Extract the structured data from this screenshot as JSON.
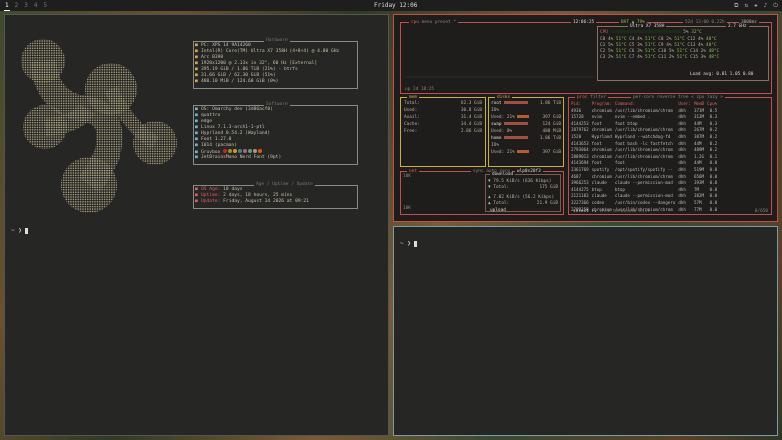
{
  "topbar": {
    "workspaces": [
      "1",
      "2",
      "3",
      "4",
      "5"
    ],
    "clock": "Friday 12:06",
    "tray": [
      "⧉",
      "⇅",
      "✚",
      "♪",
      "⏻"
    ]
  },
  "term1": {
    "prompt": "~ ❯",
    "sysbox_title": "Hardware",
    "sys_lines": [
      {
        "icon": "▪",
        "key": "PC:",
        "val": "XPS 14 9A14260"
      },
      {
        "icon": "▪",
        "key": "",
        "val": "Intel(R) Core(TM) Ultra X7 358H (4+8+4) @ 4.80 GHz"
      },
      {
        "icon": "▪",
        "key": "",
        "val": "Arc B390"
      },
      {
        "icon": "▪",
        "key": "",
        "val": "1920x1200 @ 2.13x in 32\", 60 Hz [External]"
      },
      {
        "icon": "▪",
        "key": "",
        "val": "395.19 GiB / 1.86 TiB (21%) - btrfs"
      },
      {
        "icon": "▪",
        "key": "",
        "val": "31.66 GiB / 62.30 GiB (51%)"
      },
      {
        "icon": "▪",
        "key": "",
        "val": "480.10 MiB / 124.60 GiB (0%)"
      }
    ],
    "swbox_title": "Software",
    "sw_lines": [
      {
        "key": "OS:",
        "val": "Omarchy dev (3d86acf0)"
      },
      {
        "key": "",
        "val": "quattro"
      },
      {
        "key": "",
        "val": "edge"
      },
      {
        "key": "",
        "val": "Linux 7.1.3-arch1-1-ptl"
      },
      {
        "key": "",
        "val": "Hyprland 0.54.2 (Wayland)"
      },
      {
        "key": "",
        "val": "Foot 1.27.0"
      },
      {
        "key": "",
        "val": "1014 (pacman)"
      },
      {
        "key": "",
        "val": "Gruvbox"
      },
      {
        "key": "",
        "val": "JetBrainsMono Nerd Font (9pt)"
      }
    ],
    "upbox_title": "Age / Uptime / Update",
    "up_lines": [
      {
        "key": "OS Age:",
        "val": "10 days"
      },
      {
        "key": "Uptime:",
        "val": "2 days, 18 hours, 25 mins"
      },
      {
        "key": "Update:",
        "val": "Friday, August 14 2026 at 09:21"
      }
    ],
    "palette": [
      "#cc241d",
      "#98971a",
      "#d79921",
      "#458588",
      "#b16286",
      "#689d6a",
      "#a89984",
      "#d65d0e"
    ]
  },
  "btop": {
    "cpu_title": "cpu",
    "menu": "menu",
    "preset": "preset *",
    "time": "12:06:25",
    "bat": "BAT ▲ 79%",
    "uptime_hdr": "52d 13:00 0.22h",
    "freq": "3000ms",
    "up": "up 2d 18:25",
    "cpu_model": "Ultra X7 358H",
    "cpu_total_ghz": "2.7 GHz",
    "cpu_rows": [
      [
        "CPU",
        "5%",
        "32°C"
      ],
      [
        "C0",
        "4%",
        "51°C",
        "C4",
        "4%",
        "51°C",
        "C8",
        "2%",
        "51°C",
        "C12",
        "4%",
        "48°C"
      ],
      [
        "C1",
        "5%",
        "51°C",
        "C5",
        "3%",
        "51°C",
        "C9",
        "4%",
        "51°C",
        "C13",
        "4%",
        "48°C"
      ],
      [
        "C2",
        "5%",
        "51°C",
        "C6",
        "3%",
        "51°C",
        "C10",
        "5%",
        "51°C",
        "C14",
        "2%",
        "48°C"
      ],
      [
        "C3",
        "2%",
        "51°C",
        "C7",
        "4%",
        "51°C",
        "C11",
        "2%",
        "51°C",
        "C15",
        "3%",
        "48°C"
      ]
    ],
    "load_avg": "Load avg: 0.81 1.05 0.80",
    "mem_title": "mem",
    "mem": [
      [
        "Total:",
        "62.3 GiB"
      ],
      [
        "Used:",
        "30.8 GiB"
      ],
      [
        "Avail:",
        "31.4 GiB"
      ],
      [
        "Cache:",
        "34.4 GiB"
      ],
      [
        "Free:",
        "2.86 GiB"
      ]
    ],
    "disks_title": "disks",
    "disks": [
      [
        "root",
        "1.86 TiB"
      ],
      [
        "IO%",
        ""
      ],
      [
        "Used: 21%",
        "397 GiB"
      ],
      [
        "swap",
        "124 GiB"
      ],
      [
        "Used: 0%",
        "488 MiB"
      ],
      [
        "home",
        "1.86 TiB"
      ],
      [
        "IO%",
        ""
      ],
      [
        "Used: 21%",
        "397 GiB"
      ]
    ],
    "net_title": "net",
    "net_sync": "sync auto zero",
    "net_iface": "wlp0s20f3",
    "net_scale_top": "10K",
    "net_scale_bot": "10K",
    "download": "download",
    "dl_rate": "79.5 KiB/s (636 Kibps)",
    "dl_total_lbl": "Total:",
    "dl_total": "175 GiB",
    "ul_rate": "7.02 KiB/s (56.2 Kibps)",
    "ul_total_lbl": "Total:",
    "ul_total": "21.9 GiB",
    "upload": "upload",
    "proc_title": "proc",
    "proc_filter": "filter",
    "proc_opts": "per-core reverse tree < cpu lazy >",
    "proc_headers": [
      "Pid:",
      "Program:",
      "Command:",
      "User:",
      "MemB",
      "Cpu%"
    ],
    "procs": [
      [
        "4936",
        "chromium",
        "/usr/lib/chromium/chrom",
        "dhh",
        "371M",
        "0.5"
      ],
      [
        "15728",
        "nvim",
        "nvim --embed .",
        "dhh",
        "313M",
        "0.3"
      ],
      [
        "4144253",
        "foot",
        "foot btop",
        "dhh",
        "44M",
        "0.3"
      ],
      [
        "2879762",
        "chromium",
        "/usr/lib/chromium/chrom",
        "dhh",
        "267M",
        "0.2"
      ],
      [
        "1520",
        "Hyprland",
        "Hyprland --watchdog-fd",
        "dhh",
        "387M",
        "0.2"
      ],
      [
        "4143653",
        "foot",
        "foot bash -lc fastfetch",
        "dhh",
        "44M",
        "0.2"
      ],
      [
        "2793064",
        "chromium",
        "/usr/lib/chromium/chrom",
        "dhh",
        "489M",
        "0.2"
      ],
      [
        "2889013",
        "chromium",
        "/usr/lib/chromium/chrom",
        "dhh",
        "1.2G",
        "0.1"
      ],
      [
        "4143694",
        "foot",
        "foot",
        "dhh",
        "44M",
        "0.0"
      ],
      [
        "2361769",
        "spotify",
        "/opt/spotify/spotify --",
        "dhh",
        "519M",
        "0.0"
      ],
      [
        "4687",
        "chromium",
        "/usr/lib/chromium/chrom",
        "dhh",
        "656M",
        "0.0"
      ],
      [
        "3966253",
        "claude",
        "claude --permission-mod",
        "dhh",
        "393M",
        "0.0"
      ],
      [
        "4144275",
        "btop",
        "btop",
        "dhh",
        "7M",
        "0.0"
      ],
      [
        "2121103",
        "claude",
        "claude --permission-mod",
        "dhh",
        "382M",
        "0.0"
      ],
      [
        "3227366",
        "codex",
        "/usr/bin/codex --dangero",
        "dhh",
        "57M",
        "0.0"
      ],
      [
        "2793258",
        "chromium",
        "/usr/lib/chromium/chrom",
        "dhh",
        "77M",
        "0.0"
      ]
    ],
    "proc_footer_select": "select ↑↓",
    "proc_footer_info": "info",
    "proc_footer_term": "terminate",
    "proc_footer_kill": "kill",
    "proc_footer_count": "0/650"
  },
  "term3": {
    "prompt": "~ ❯"
  }
}
